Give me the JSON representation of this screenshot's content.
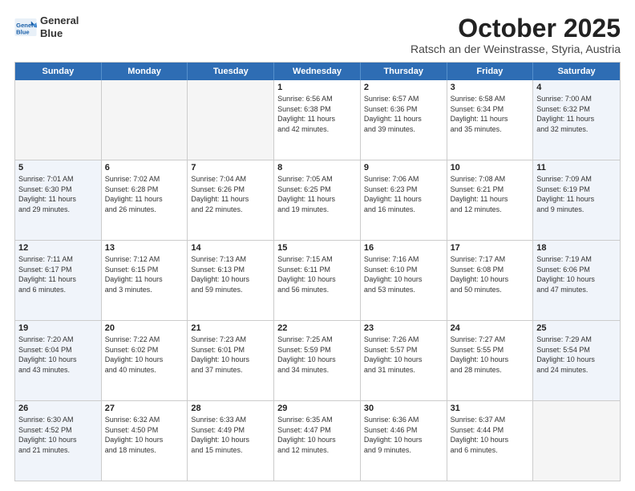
{
  "header": {
    "logo_line1": "General",
    "logo_line2": "Blue",
    "month": "October 2025",
    "location": "Ratsch an der Weinstrasse, Styria, Austria"
  },
  "weekdays": [
    "Sunday",
    "Monday",
    "Tuesday",
    "Wednesday",
    "Thursday",
    "Friday",
    "Saturday"
  ],
  "rows": [
    [
      {
        "day": "",
        "info": "",
        "empty": true
      },
      {
        "day": "",
        "info": "",
        "empty": true
      },
      {
        "day": "",
        "info": "",
        "empty": true
      },
      {
        "day": "1",
        "info": "Sunrise: 6:56 AM\nSunset: 6:38 PM\nDaylight: 11 hours\nand 42 minutes.",
        "empty": false
      },
      {
        "day": "2",
        "info": "Sunrise: 6:57 AM\nSunset: 6:36 PM\nDaylight: 11 hours\nand 39 minutes.",
        "empty": false
      },
      {
        "day": "3",
        "info": "Sunrise: 6:58 AM\nSunset: 6:34 PM\nDaylight: 11 hours\nand 35 minutes.",
        "empty": false
      },
      {
        "day": "4",
        "info": "Sunrise: 7:00 AM\nSunset: 6:32 PM\nDaylight: 11 hours\nand 32 minutes.",
        "empty": false,
        "shaded": true
      }
    ],
    [
      {
        "day": "5",
        "info": "Sunrise: 7:01 AM\nSunset: 6:30 PM\nDaylight: 11 hours\nand 29 minutes.",
        "empty": false,
        "shaded": true
      },
      {
        "day": "6",
        "info": "Sunrise: 7:02 AM\nSunset: 6:28 PM\nDaylight: 11 hours\nand 26 minutes.",
        "empty": false
      },
      {
        "day": "7",
        "info": "Sunrise: 7:04 AM\nSunset: 6:26 PM\nDaylight: 11 hours\nand 22 minutes.",
        "empty": false
      },
      {
        "day": "8",
        "info": "Sunrise: 7:05 AM\nSunset: 6:25 PM\nDaylight: 11 hours\nand 19 minutes.",
        "empty": false
      },
      {
        "day": "9",
        "info": "Sunrise: 7:06 AM\nSunset: 6:23 PM\nDaylight: 11 hours\nand 16 minutes.",
        "empty": false
      },
      {
        "day": "10",
        "info": "Sunrise: 7:08 AM\nSunset: 6:21 PM\nDaylight: 11 hours\nand 12 minutes.",
        "empty": false
      },
      {
        "day": "11",
        "info": "Sunrise: 7:09 AM\nSunset: 6:19 PM\nDaylight: 11 hours\nand 9 minutes.",
        "empty": false,
        "shaded": true
      }
    ],
    [
      {
        "day": "12",
        "info": "Sunrise: 7:11 AM\nSunset: 6:17 PM\nDaylight: 11 hours\nand 6 minutes.",
        "empty": false,
        "shaded": true
      },
      {
        "day": "13",
        "info": "Sunrise: 7:12 AM\nSunset: 6:15 PM\nDaylight: 11 hours\nand 3 minutes.",
        "empty": false
      },
      {
        "day": "14",
        "info": "Sunrise: 7:13 AM\nSunset: 6:13 PM\nDaylight: 10 hours\nand 59 minutes.",
        "empty": false
      },
      {
        "day": "15",
        "info": "Sunrise: 7:15 AM\nSunset: 6:11 PM\nDaylight: 10 hours\nand 56 minutes.",
        "empty": false
      },
      {
        "day": "16",
        "info": "Sunrise: 7:16 AM\nSunset: 6:10 PM\nDaylight: 10 hours\nand 53 minutes.",
        "empty": false
      },
      {
        "day": "17",
        "info": "Sunrise: 7:17 AM\nSunset: 6:08 PM\nDaylight: 10 hours\nand 50 minutes.",
        "empty": false
      },
      {
        "day": "18",
        "info": "Sunrise: 7:19 AM\nSunset: 6:06 PM\nDaylight: 10 hours\nand 47 minutes.",
        "empty": false,
        "shaded": true
      }
    ],
    [
      {
        "day": "19",
        "info": "Sunrise: 7:20 AM\nSunset: 6:04 PM\nDaylight: 10 hours\nand 43 minutes.",
        "empty": false,
        "shaded": true
      },
      {
        "day": "20",
        "info": "Sunrise: 7:22 AM\nSunset: 6:02 PM\nDaylight: 10 hours\nand 40 minutes.",
        "empty": false
      },
      {
        "day": "21",
        "info": "Sunrise: 7:23 AM\nSunset: 6:01 PM\nDaylight: 10 hours\nand 37 minutes.",
        "empty": false
      },
      {
        "day": "22",
        "info": "Sunrise: 7:25 AM\nSunset: 5:59 PM\nDaylight: 10 hours\nand 34 minutes.",
        "empty": false
      },
      {
        "day": "23",
        "info": "Sunrise: 7:26 AM\nSunset: 5:57 PM\nDaylight: 10 hours\nand 31 minutes.",
        "empty": false
      },
      {
        "day": "24",
        "info": "Sunrise: 7:27 AM\nSunset: 5:55 PM\nDaylight: 10 hours\nand 28 minutes.",
        "empty": false
      },
      {
        "day": "25",
        "info": "Sunrise: 7:29 AM\nSunset: 5:54 PM\nDaylight: 10 hours\nand 24 minutes.",
        "empty": false,
        "shaded": true
      }
    ],
    [
      {
        "day": "26",
        "info": "Sunrise: 6:30 AM\nSunset: 4:52 PM\nDaylight: 10 hours\nand 21 minutes.",
        "empty": false,
        "shaded": true
      },
      {
        "day": "27",
        "info": "Sunrise: 6:32 AM\nSunset: 4:50 PM\nDaylight: 10 hours\nand 18 minutes.",
        "empty": false
      },
      {
        "day": "28",
        "info": "Sunrise: 6:33 AM\nSunset: 4:49 PM\nDaylight: 10 hours\nand 15 minutes.",
        "empty": false
      },
      {
        "day": "29",
        "info": "Sunrise: 6:35 AM\nSunset: 4:47 PM\nDaylight: 10 hours\nand 12 minutes.",
        "empty": false
      },
      {
        "day": "30",
        "info": "Sunrise: 6:36 AM\nSunset: 4:46 PM\nDaylight: 10 hours\nand 9 minutes.",
        "empty": false
      },
      {
        "day": "31",
        "info": "Sunrise: 6:37 AM\nSunset: 4:44 PM\nDaylight: 10 hours\nand 6 minutes.",
        "empty": false
      },
      {
        "day": "",
        "info": "",
        "empty": true
      }
    ]
  ]
}
